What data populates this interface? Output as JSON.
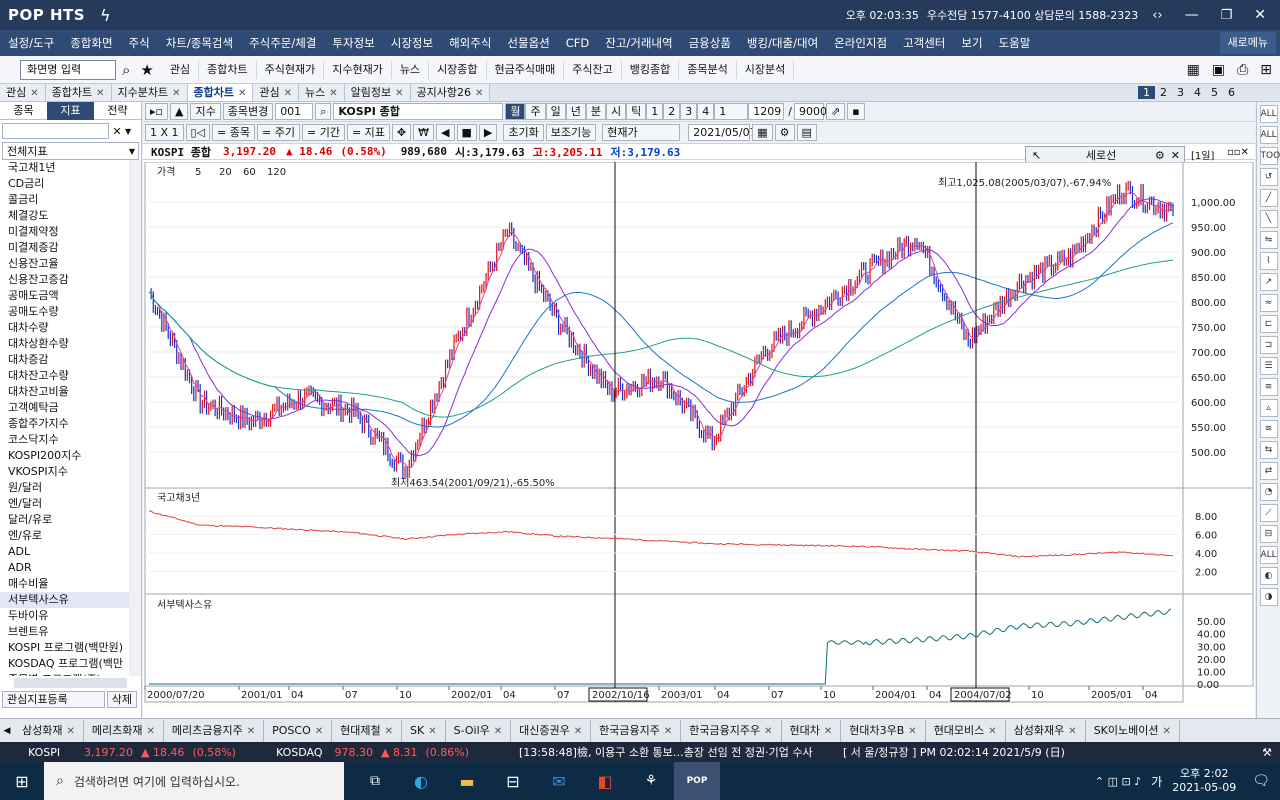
{
  "app": {
    "logo": "POP HTS",
    "time": "오후 02:03:35",
    "contact": "우수전담 1577-4100 상담문의 1588-2323"
  },
  "menu": [
    "설정/도구",
    "종합화면",
    "주식",
    "차트/종목검색",
    "주식주문/체결",
    "투자정보",
    "시장정보",
    "해외주식",
    "선물옵션",
    "CFD",
    "잔고/거래내역",
    "금융상품",
    "뱅킹/대출/대여",
    "온라인지점",
    "고객센터",
    "보기",
    "도움말"
  ],
  "menu_right": "새로메뉴",
  "toolbar": {
    "screen_input": "화면명 입력",
    "items": [
      "관심",
      "종합차트",
      "주식현재가",
      "지수현재가",
      "뉴스",
      "시장종합",
      "현금주식매매",
      "주식잔고",
      "뱅킹종합",
      "종목분석",
      "시장분석"
    ]
  },
  "tabs": [
    "관심",
    "종합차트",
    "지수분차트",
    "종합차트",
    "관심",
    "뉴스",
    "알림정보",
    "공지사항26"
  ],
  "tab_pages": [
    "1",
    "2",
    "3",
    "4",
    "5",
    "6"
  ],
  "left": {
    "tabs": [
      "종목",
      "지표",
      "전략"
    ],
    "dropdown": "전체지표",
    "items": [
      "국고채1년",
      "CD금리",
      "콜금리",
      "체결강도",
      "미결제약정",
      "미결제증감",
      "신용잔고율",
      "신용잔고증감",
      "공매도금액",
      "공매도수량",
      "대차수량",
      "대차상환수량",
      "대차증감",
      "대차잔고수량",
      "대차잔고비율",
      "고객예탁금",
      "종합주가지수",
      "코스닥지수",
      "KOSPI200지수",
      "VKOSPI지수",
      "원/달러",
      "엔/달러",
      "달러/유로",
      "엔/유로",
      "ADL",
      "ADR",
      "매수비율",
      "서부텍사스유",
      "두바이유",
      "브렌트유",
      "KOSPI 프로그램(백만원)",
      "KOSDAQ 프로그램(백만",
      "종목별 프로그램(주)"
    ],
    "register": "관심지표등록",
    "delete": "삭제"
  },
  "chart_ctl": {
    "type": "지수",
    "change": "종목변경",
    "code": "001",
    "name": "KOSPI 종합",
    "periods": [
      "월",
      "주",
      "일",
      "년",
      "분",
      "시",
      "틱"
    ],
    "nums": [
      "1",
      "2",
      "3",
      "4",
      "1"
    ],
    "count": "1209",
    "total": "9000",
    "mode": "현재가",
    "date": "2021/05/07",
    "init": "초기화",
    "aux": "보조기능",
    "compare": [
      "= 종목",
      "= 주기",
      "= 기간",
      "= 지표"
    ],
    "zoom": "1 X 1"
  },
  "info": {
    "name": "KOSPI 종합",
    "price": "3,197.20",
    "change": "▲ 18.46",
    "pct": "(0.58%)",
    "volume": "989,680",
    "open": "시:3,179.63",
    "high": "고:3,205.11",
    "low": "저:3,179.63"
  },
  "panel_tools": {
    "label": "세로선",
    "period": "[1일]"
  },
  "legend": {
    "price": "가격",
    "ma": [
      "5",
      "20",
      "60",
      "120"
    ]
  },
  "annotations": {
    "high": "최고1,025.08(2005/03/07),-67.94%",
    "low": "최저463.54(2001/09/21),-65.50%"
  },
  "panes": {
    "bond": "국고채3년",
    "oil": "서부텍사스유"
  },
  "axes": {
    "price": [
      "1,000.00",
      "950.00",
      "900.00",
      "850.00",
      "800.00",
      "750.00",
      "700.00",
      "650.00",
      "600.00",
      "550.00",
      "500.00"
    ],
    "bond": [
      "8.00",
      "6.00",
      "4.00",
      "2.00"
    ],
    "oil": [
      "50.00",
      "40.00",
      "30.00",
      "20.00",
      "10.00",
      "0.00"
    ],
    "x": [
      "2000/07/20",
      "2001/01",
      "04",
      "07",
      "10",
      "2002/01",
      "04",
      "07",
      "2003/01",
      "04",
      "07",
      "10",
      "2004/01",
      "04",
      "10",
      "2005/01",
      "04"
    ],
    "vline1": "2002/10/16",
    "vline2": "2004/07/02"
  },
  "stocks": [
    "삼성화재",
    "메리츠화재",
    "메리츠금융지주",
    "POSCO",
    "현대제철",
    "SK",
    "S-Oil우",
    "대신증권우",
    "한국금융지주",
    "한국금융지주우",
    "현대차",
    "현대차3우B",
    "현대모비스",
    "삼성화재우",
    "SK이노베이션"
  ],
  "ticker": {
    "kospi_label": "KOSPI",
    "kospi_val": "3,197.20",
    "kospi_chg": "▲ 18.46",
    "kospi_pct": "(0.58%)",
    "kosdaq_label": "KOSDAQ",
    "kosdaq_val": "978.30",
    "kosdaq_chg": "▲ 8.31",
    "kosdaq_pct": "(0.86%)",
    "news": "[13:58:48]檢, 이용구 소환 통보…총장 선임 전 정권·기업 수사",
    "status": "[ 서 울/정규장 ] PM 02:02:14 2021/5/9 (日)"
  },
  "taskbar": {
    "search": "검색하려면 여기에 입력하십시오.",
    "time": "오후 2:02",
    "date": "2021-05-09",
    "lang": "가"
  },
  "chart_data": {
    "type": "line",
    "series": [
      {
        "name": "가격",
        "x": [
          "2000/07",
          "2000/10",
          "2001/01",
          "2001/04",
          "2001/07",
          "2001/09",
          "2002/01",
          "2002/04",
          "2002/07",
          "2002/10",
          "2003/01",
          "2003/03",
          "2003/07",
          "2003/10",
          "2004/01",
          "2004/04",
          "2004/07",
          "2004/10",
          "2005/01",
          "2005/03",
          "2005/05"
        ],
        "values": [
          820,
          600,
          560,
          610,
          580,
          464,
          720,
          940,
          760,
          620,
          650,
          520,
          700,
          780,
          860,
          930,
          720,
          840,
          890,
          1025,
          980
        ]
      },
      {
        "name": "국고채3년",
        "values": [
          8.5,
          7.0,
          6.8,
          6.5,
          6.2,
          5.5,
          6.0,
          6.3,
          5.8,
          5.6,
          5.3,
          5.0,
          4.9,
          4.8,
          4.7,
          4.4,
          4.2,
          3.6,
          3.8,
          4.1,
          3.7
        ]
      },
      {
        "name": "서부텍사스유",
        "values": [
          0,
          0,
          0,
          0,
          0,
          0,
          0,
          0,
          0,
          0,
          0,
          0,
          0,
          0,
          33,
          35,
          38,
          46,
          48,
          53,
          58
        ]
      }
    ]
  }
}
